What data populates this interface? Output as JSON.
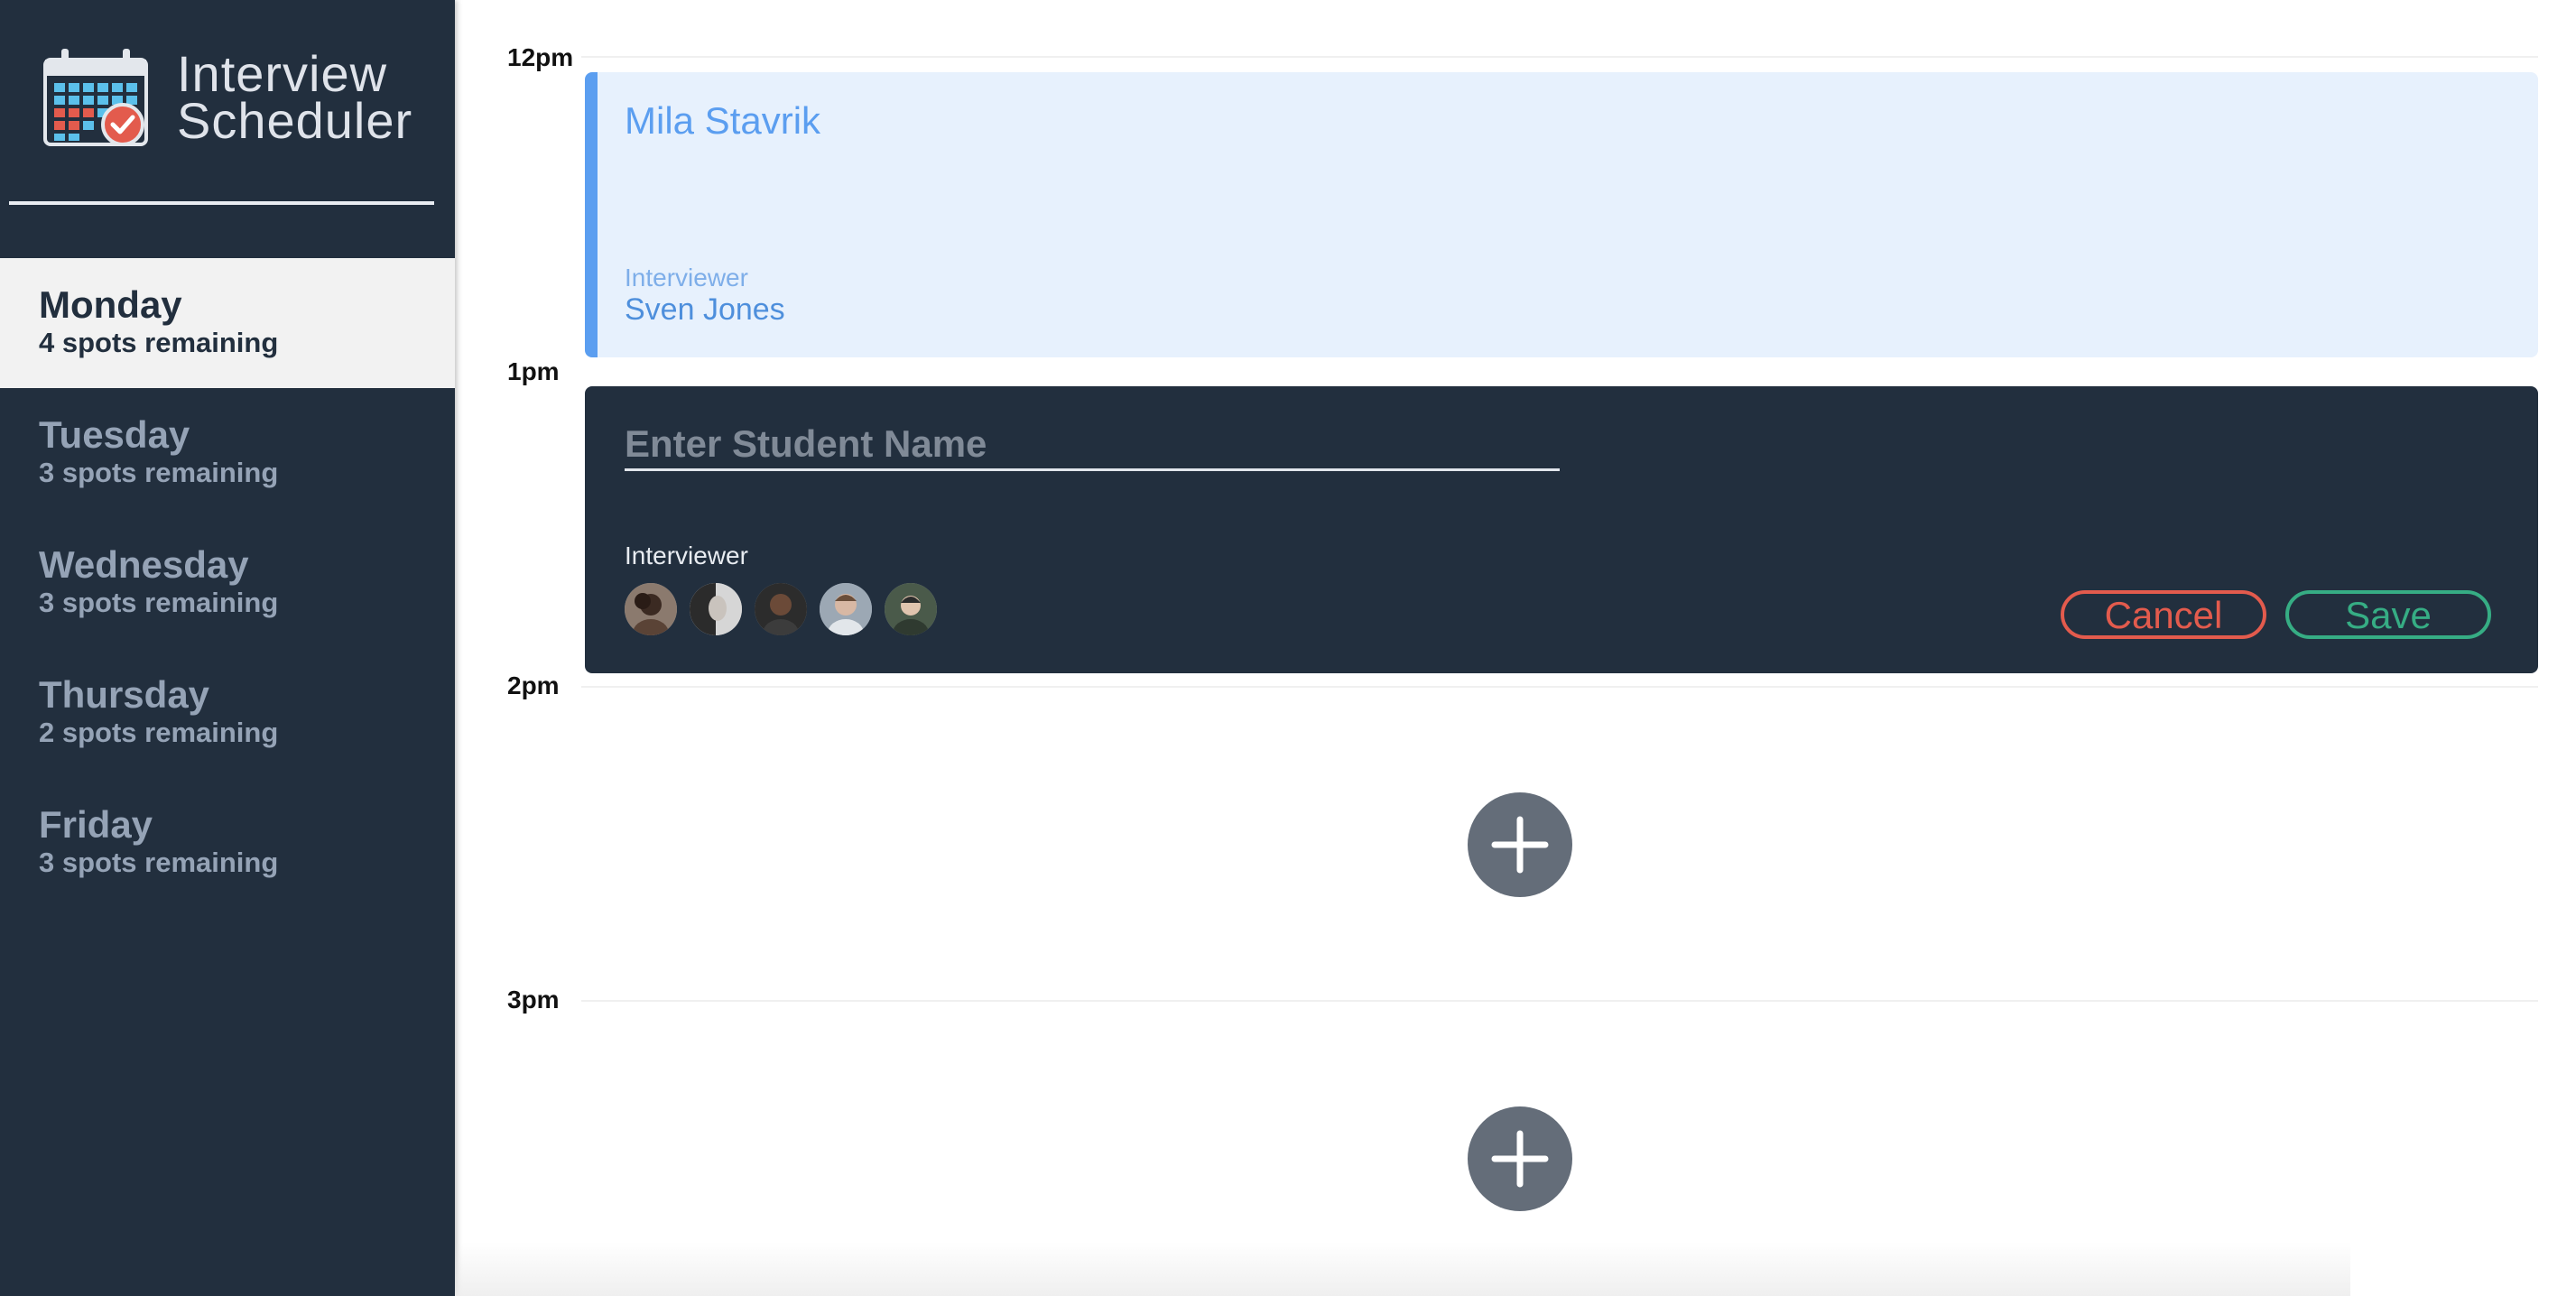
{
  "app": {
    "title_line1": "Interview",
    "title_line2": "Scheduler",
    "logo_icon": "calendar-check-icon"
  },
  "sidebar": {
    "days": [
      {
        "name": "Monday",
        "spots": "4 spots remaining",
        "selected": true
      },
      {
        "name": "Tuesday",
        "spots": "3 spots remaining",
        "selected": false
      },
      {
        "name": "Wednesday",
        "spots": "3 spots remaining",
        "selected": false
      },
      {
        "name": "Thursday",
        "spots": "2 spots remaining",
        "selected": false
      },
      {
        "name": "Friday",
        "spots": "3 spots remaining",
        "selected": false
      }
    ]
  },
  "schedule": {
    "times": [
      "12pm",
      "1pm",
      "2pm",
      "3pm"
    ],
    "booked": {
      "student": "Mila Stavrik",
      "interviewer_label": "Interviewer",
      "interviewer_name": "Sven Jones"
    },
    "form": {
      "placeholder": "Enter Student Name",
      "interviewer_label": "Interviewer",
      "avatar_count": 5,
      "cancel_label": "Cancel",
      "save_label": "Save"
    },
    "add_icon": "plus-icon"
  },
  "colors": {
    "sidebar_bg": "#222f3e",
    "booked_accent": "#5b9ef0",
    "cancel": "#e35b4d",
    "save": "#36ad84",
    "add_button": "#646d79"
  }
}
